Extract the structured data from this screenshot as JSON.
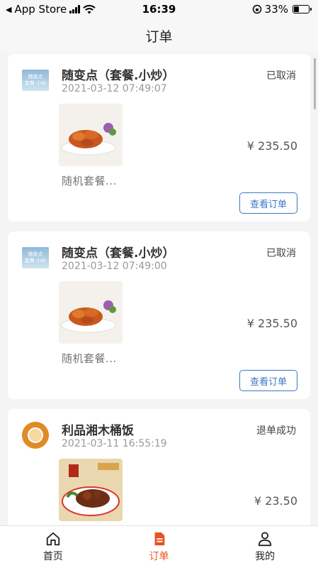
{
  "status_bar": {
    "back_app": "App Store",
    "time": "16:39",
    "battery": "33%",
    "battery_level": 0.33
  },
  "header": {
    "title": "订单"
  },
  "orders": [
    {
      "store": "随变点（套餐.小炒）",
      "time": "2021-03-12 07:49:07",
      "status": "已取消",
      "price": "¥ 235.50",
      "dish": "随机套餐...",
      "action": "查看订单",
      "logo": "store-logo-square"
    },
    {
      "store": "随变点（套餐.小炒）",
      "time": "2021-03-12 07:49:00",
      "status": "已取消",
      "price": "¥ 235.50",
      "dish": "随机套餐...",
      "action": "查看订单",
      "logo": "store-logo-square"
    },
    {
      "store": "利品湘木桶饭",
      "time": "2021-03-11 16:55:19",
      "status": "退单成功",
      "price": "¥ 23.50",
      "logo": "store-logo-round"
    }
  ],
  "tabs": [
    {
      "label": "首页",
      "icon": "home-icon",
      "active": false
    },
    {
      "label": "订单",
      "icon": "order-document-icon",
      "active": true
    },
    {
      "label": "我的",
      "icon": "user-profile-icon",
      "active": false
    }
  ],
  "colors": {
    "accent": "#e8531f",
    "link": "#3a77c9"
  }
}
